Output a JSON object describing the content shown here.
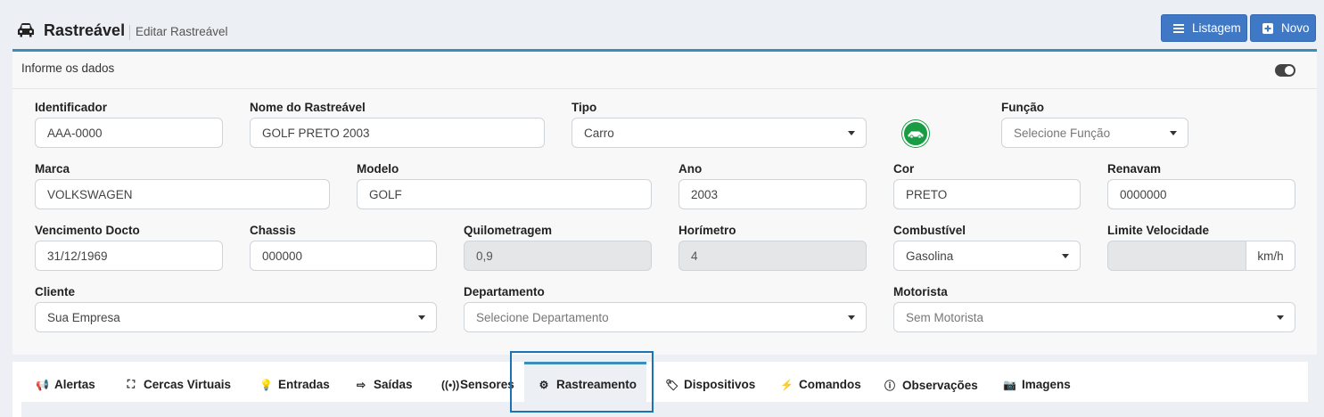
{
  "header": {
    "icon": "car-icon",
    "title": "Rastreável",
    "subtitle": "Editar Rastreável",
    "buttons": {
      "list_label": "Listagem",
      "new_label": "Novo"
    }
  },
  "card": {
    "title": "Informe os dados"
  },
  "form": {
    "identificador": {
      "label": "Identificador",
      "value": "AAA-0000"
    },
    "nome": {
      "label": "Nome do Rastreável",
      "value": "GOLF PRETO 2003"
    },
    "tipo": {
      "label": "Tipo",
      "value": "Carro"
    },
    "funcao": {
      "label": "Função",
      "placeholder": "Selecione Função"
    },
    "marca": {
      "label": "Marca",
      "value": "VOLKSWAGEN"
    },
    "modelo": {
      "label": "Modelo",
      "value": "GOLF"
    },
    "ano": {
      "label": "Ano",
      "value": "2003"
    },
    "cor": {
      "label": "Cor",
      "value": "PRETO"
    },
    "renavam": {
      "label": "Renavam",
      "value": "0000000"
    },
    "vencimento": {
      "label": "Vencimento Docto",
      "value": "31/12/1969"
    },
    "chassis": {
      "label": "Chassis",
      "value": "000000"
    },
    "quilometragem": {
      "label": "Quilometragem",
      "value": "0,9"
    },
    "horimetro": {
      "label": "Horímetro",
      "value": "4"
    },
    "combustivel": {
      "label": "Combustível",
      "value": "Gasolina"
    },
    "limite": {
      "label": "Limite Velocidade",
      "value": "",
      "unit": "km/h"
    },
    "cliente": {
      "label": "Cliente",
      "value": "Sua Empresa"
    },
    "departamento": {
      "label": "Departamento",
      "placeholder": "Selecione Departamento"
    },
    "motorista": {
      "label": "Motorista",
      "value": "Sem Motorista"
    }
  },
  "tabs": [
    {
      "label": "Alertas",
      "icon": "bullhorn-icon"
    },
    {
      "label": "Cercas Virtuais",
      "icon": "fence-icon"
    },
    {
      "label": "Entradas",
      "icon": "lightbulb-icon"
    },
    {
      "label": "Saídas",
      "icon": "sign-out-icon"
    },
    {
      "label": "Sensores",
      "icon": "signal-icon"
    },
    {
      "label": "Rastreamento",
      "icon": "gear-icon",
      "active": true
    },
    {
      "label": "Dispositivos",
      "icon": "tags-icon"
    },
    {
      "label": "Comandos",
      "icon": "bolt-icon"
    },
    {
      "label": "Observações",
      "icon": "info-circle-icon"
    },
    {
      "label": "Imagens",
      "icon": "camera-icon"
    }
  ],
  "colors": {
    "primary": "#3f78c4",
    "accent": "#3c8dbc",
    "badge": "#1a9c45",
    "highlight": "#1a73b5"
  }
}
